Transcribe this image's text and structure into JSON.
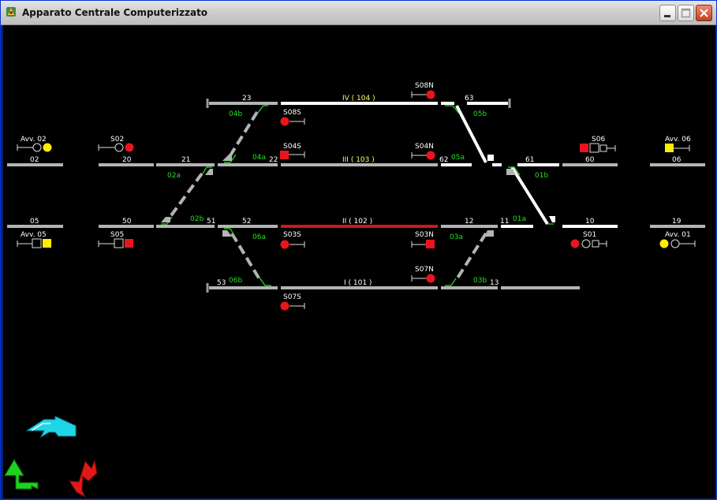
{
  "window": {
    "title": "Apparato Centrale Computerizzato"
  },
  "colors": {
    "background": "#000000",
    "track_free": "#b4b4b4",
    "track_route": "#ffffff",
    "track_occupied": "#d01818",
    "signal_red": "#e8141e",
    "signal_yellow": "#ffee00",
    "label_green": "#22e020",
    "cursor_cyan": "#1fd6e6",
    "back_green": "#1ed21e",
    "cancel_red": "#e11818"
  },
  "tracks": {
    "s02": "02",
    "s20": "20",
    "s21": "21",
    "s22": "22",
    "s23": "23",
    "s53": "53",
    "s51": "51",
    "s52": "52",
    "s50": "50",
    "s05": "05",
    "s63": "63",
    "s62": "62",
    "s61": "61",
    "s60": "60",
    "s06": "06",
    "s11": "11",
    "s12": "12",
    "s13": "13",
    "s10": "10",
    "s19": "19",
    "binario_iv": "IV ( 104 )",
    "binario_iii": "III ( 103 )",
    "binario_ii": "II ( 102 )",
    "binario_i": "I ( 101 )"
  },
  "switches": {
    "w04b": "04b",
    "w04a": "04a",
    "w02a": "02a",
    "w02b": "02b",
    "w06a": "06a",
    "w06b": "06b",
    "w05b": "05b",
    "w05a": "05a",
    "w01b": "01b",
    "w01a": "01a",
    "w03a": "03a",
    "w03b": "03b"
  },
  "signals": {
    "avv02": "Avv. 02",
    "s02": "S02",
    "s08s": "S08S",
    "s04s": "S04S",
    "s08n": "S08N",
    "s04n": "S04N",
    "s06": "S06",
    "avv06": "Avv. 06",
    "avv05": "Avv. 05",
    "s05": "S05",
    "s03s": "S03S",
    "s03n": "S03N",
    "s07n": "S07N",
    "s07s": "S07S",
    "s01": "S01",
    "avv01": "Avv. 01"
  },
  "controls": {
    "route_button_icon": "cyan-route-arrow-icon",
    "back_button_icon": "green-back-arrow-icon",
    "cancel_button_icon": "red-cancel-arrow-icon"
  }
}
